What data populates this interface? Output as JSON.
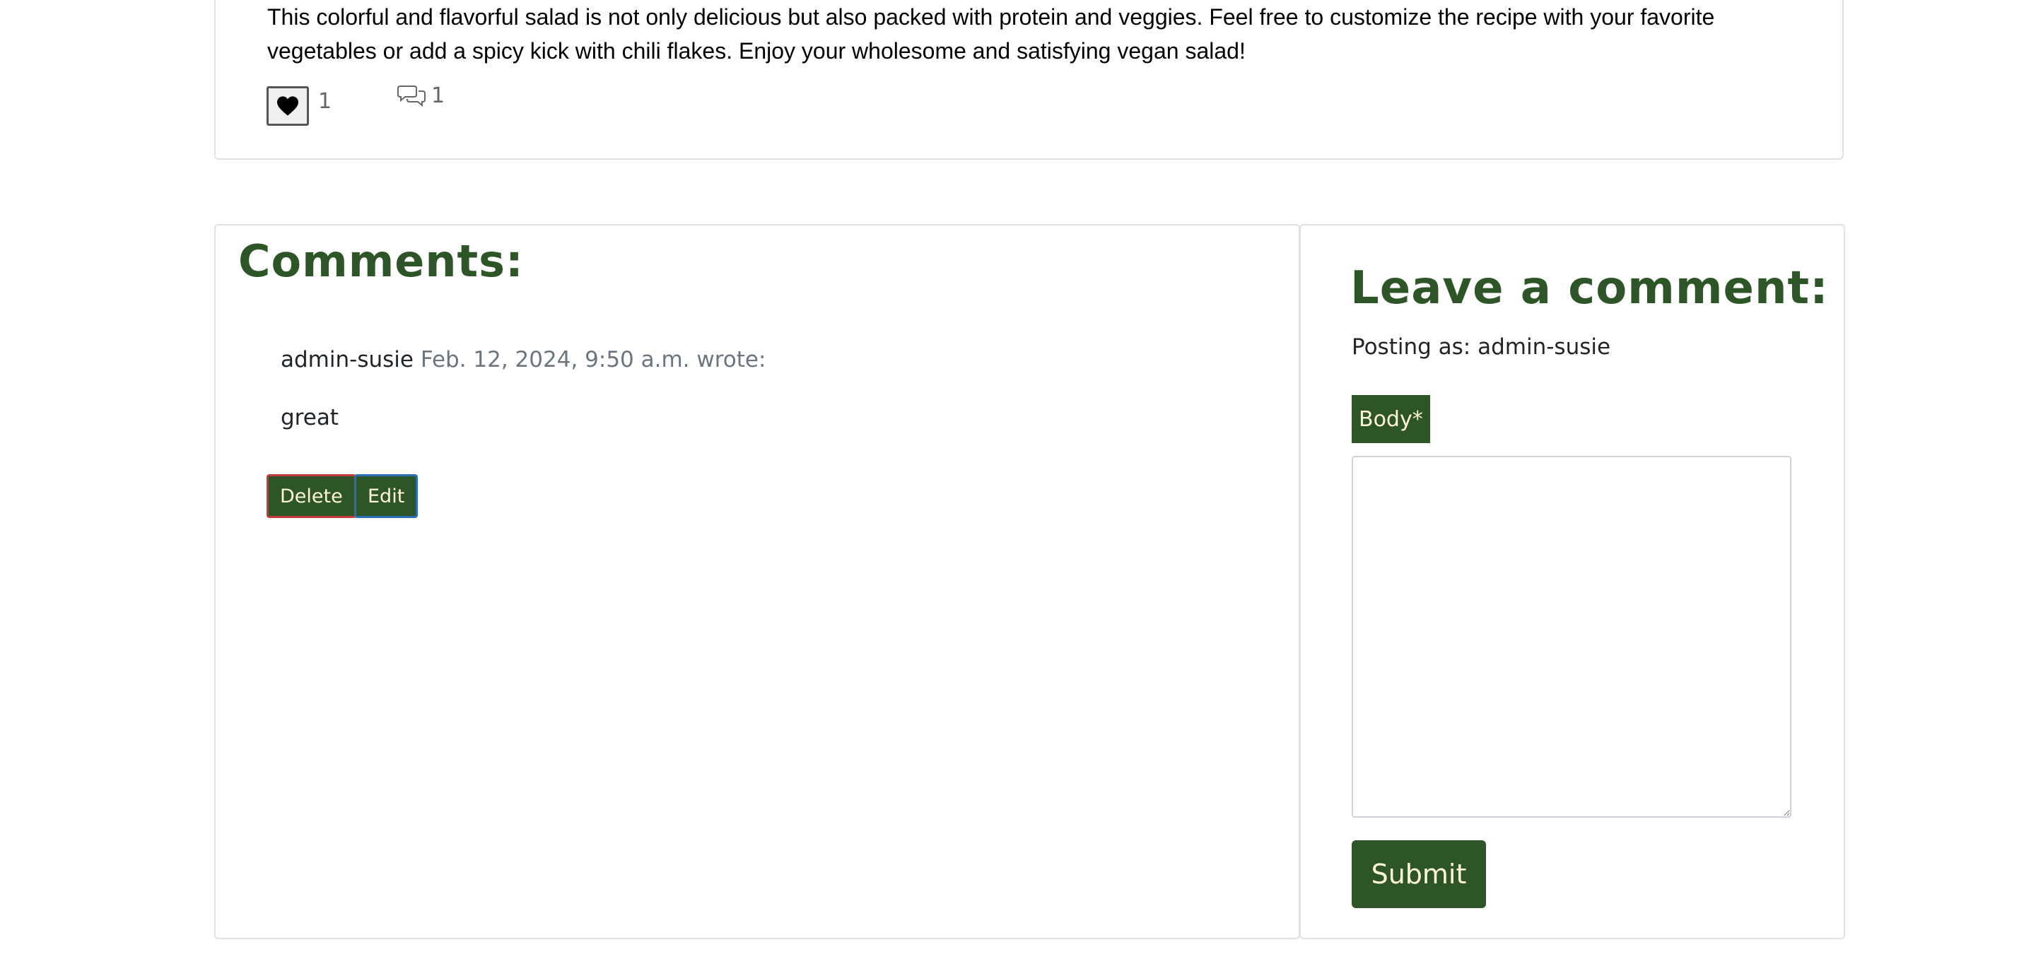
{
  "post": {
    "text": "This colorful and flavorful salad is not only delicious but also packed with protein and veggies. Feel free to customize the recipe with your favorite vegetables or add a spicy kick with chili flakes. Enjoy your wholesome and satisfying vegan salad!",
    "like_icon": "heart-icon",
    "like_count": "1",
    "comment_icon": "chat-bubbles-icon",
    "comment_count": "1"
  },
  "comments": {
    "title": "Comments:",
    "items": [
      {
        "author": "admin-susie",
        "date": "Feb. 12, 2024, 9:50 a.m. wrote:",
        "body": "great",
        "delete_label": "Delete",
        "edit_label": "Edit"
      }
    ]
  },
  "form": {
    "title": "Leave a comment:",
    "posting_as": "Posting as: admin-susie",
    "body_label": "Body*",
    "body_value": "",
    "submit_label": "Submit"
  },
  "colors": {
    "accent_green": "#2e5527",
    "button_text": "#fff7d6",
    "delete_border": "#c43b3b",
    "edit_border": "#2a6eb5"
  }
}
